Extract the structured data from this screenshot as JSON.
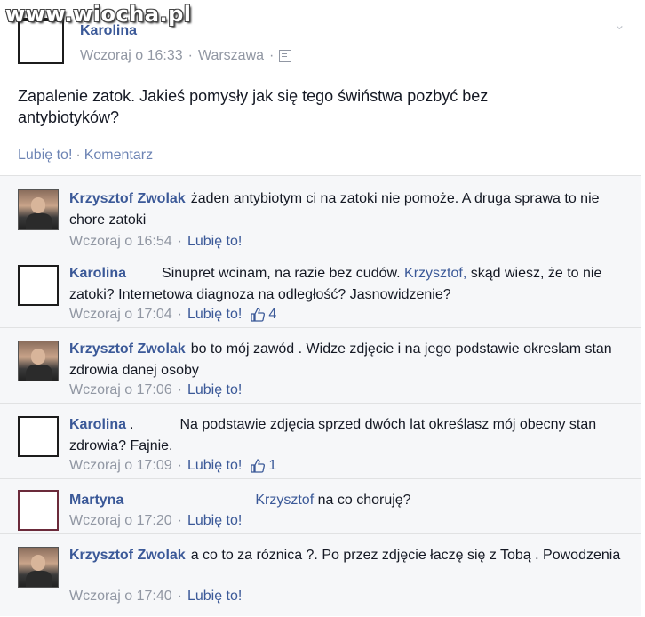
{
  "watermark": "www.wiocha.pl",
  "post": {
    "author": "Karolina",
    "time": "Wczoraj o 16:33",
    "location": "Warszawa",
    "text": "Zapalenie zatok. Jakieś pomysły jak się tego świństwa pozbyć bez antybiotyków?",
    "like_label": "Lubię to!",
    "comment_label": "Komentarz"
  },
  "comments": [
    {
      "author": "Krzysztof Zwolak",
      "text": "żaden antybiotym ci na zatoki nie pomoże. A druga sprawa to nie chore zatoki",
      "time": "Wczoraj o 16:54",
      "like": "Lubię to!",
      "likes": ""
    },
    {
      "author": "Karolina",
      "pre": "Sinupret wcinam, na razie bez cudów. ",
      "mention": "Krzysztof,",
      "text": " skąd wiesz, że to nie zatoki? Internetowa diagnoza na odległość? Jasnowidzenie?",
      "time": "Wczoraj o 17:04",
      "like": "Lubię to!",
      "likes": "4"
    },
    {
      "author": "Krzysztof Zwolak",
      "text": "bo to mój zawód . Widze zdjęcie i na jego podstawie okreslam stan zdrowia danej osoby",
      "time": "Wczoraj o 17:06",
      "like": "Lubię to!",
      "likes": ""
    },
    {
      "author": "Karolina",
      "dot": ".",
      "text": "Na podstawie zdjęcia sprzed dwóch lat określasz mój obecny stan zdrowia? Fajnie.",
      "time": "Wczoraj o 17:09",
      "like": "Lubię to!",
      "likes": "1"
    },
    {
      "author": "Martyna",
      "mention": "Krzysztof",
      "text": " na co choruję?",
      "time": "Wczoraj o 17:20",
      "like": "Lubię to!",
      "likes": ""
    },
    {
      "author": "Krzysztof Zwolak",
      "text": "a co to za róznica ?. Po przez zdjęcie łaczę się z Tobą . Powodzenia",
      "time": "Wczoraj o 17:40",
      "like": "Lubię to!",
      "likes": ""
    }
  ]
}
